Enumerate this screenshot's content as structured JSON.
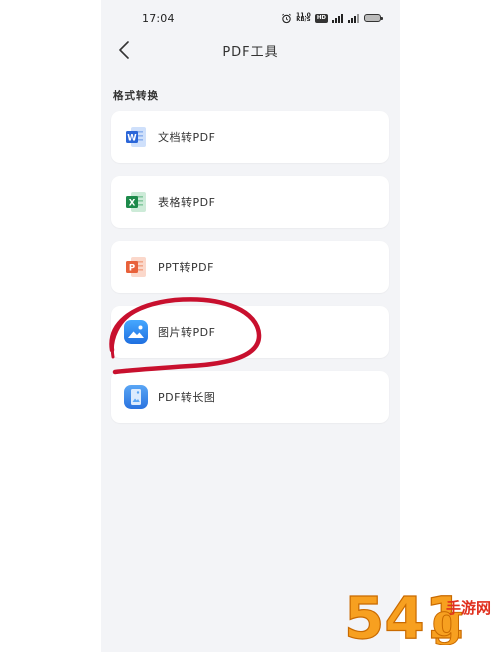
{
  "status_bar": {
    "time": "17:04",
    "net_speed_value": "11.0",
    "net_speed_unit": "KB/S",
    "hd_badge": "HD",
    "battery_level": 0.5,
    "icons": [
      "alarm-icon",
      "signal-icon",
      "wifi-icon",
      "battery-icon"
    ]
  },
  "nav": {
    "back_icon": "chevron-left-icon",
    "title": "PDF工具"
  },
  "section": {
    "title": "格式转换"
  },
  "tools": [
    {
      "label": "文档转PDF",
      "icon": "word-icon",
      "color": "#2b66d8"
    },
    {
      "label": "表格转PDF",
      "icon": "excel-icon",
      "color": "#1d8a4a"
    },
    {
      "label": "PPT转PDF",
      "icon": "powerpoint-icon",
      "color": "#e8613a"
    },
    {
      "label": "图片转PDF",
      "icon": "image-icon",
      "color": "#2f8bf0"
    },
    {
      "label": "PDF转长图",
      "icon": "long-image-icon",
      "color": "#3b86e8"
    }
  ],
  "colors": {
    "background": "#f3f4f7",
    "card": "#ffffff",
    "annotation": "#c8102e",
    "watermark_orange": "#f7a020",
    "watermark_red": "#e0301e"
  },
  "watermark": {
    "digits": "541",
    "glyph": "g",
    "text": "手游网"
  }
}
